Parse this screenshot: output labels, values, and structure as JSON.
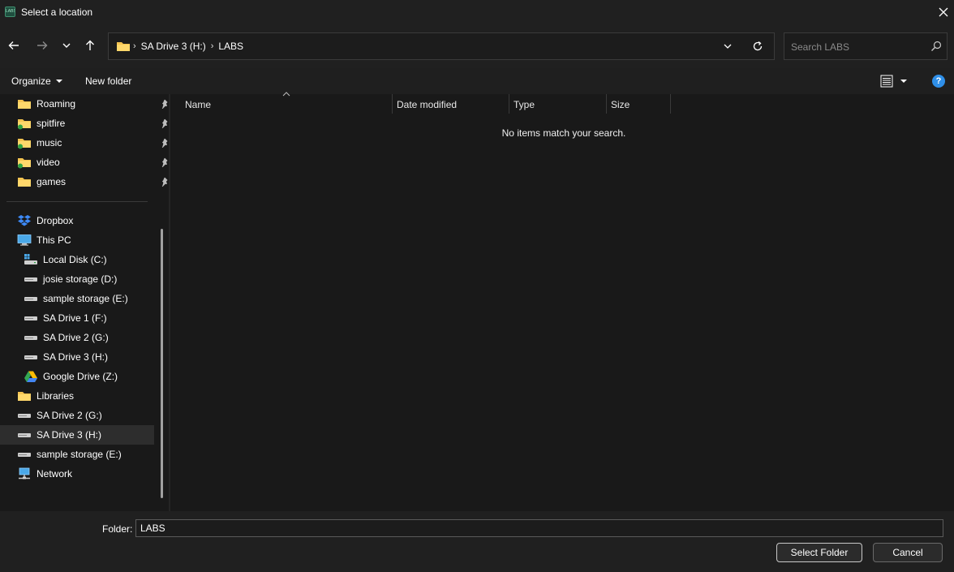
{
  "window": {
    "title": "Select a location",
    "app_icon_text": "LABS"
  },
  "nav": {
    "breadcrumbs": [
      "SA Drive 3 (H:)",
      "LABS"
    ],
    "search_placeholder": "Search LABS"
  },
  "toolbar": {
    "organize": "Organize",
    "new_folder": "New folder"
  },
  "sidebar": {
    "quick_access": [
      {
        "label": "Roaming",
        "icon": "folder-icon"
      },
      {
        "label": "spitfire",
        "icon": "folder-icon"
      },
      {
        "label": "music",
        "icon": "folder-icon"
      },
      {
        "label": "video",
        "icon": "folder-icon"
      },
      {
        "label": "games",
        "icon": "folder-icon"
      }
    ],
    "dropbox": "Dropbox",
    "this_pc": "This PC",
    "drives": [
      "Local Disk (C:)",
      "josie storage (D:)",
      "sample storage (E:)",
      "SA Drive 1 (F:)",
      "SA Drive 2 (G:)",
      "SA Drive 3 (H:)",
      "Google Drive (Z:)"
    ],
    "libraries": "Libraries",
    "extra": [
      "SA Drive 2 (G:)",
      "SA Drive 3 (H:)",
      "sample storage (E:)"
    ],
    "network": "Network",
    "selected": "SA Drive 3 (H:)"
  },
  "columns": [
    "Name",
    "Date modified",
    "Type",
    "Size"
  ],
  "empty_message": "No items match your search.",
  "footer": {
    "folder_label": "Folder:",
    "folder_value": "LABS",
    "select_button": "Select Folder",
    "cancel_button": "Cancel"
  },
  "colors": {
    "accent": "#2f8fe8",
    "folder": "#f5c451",
    "background": "#191919"
  }
}
